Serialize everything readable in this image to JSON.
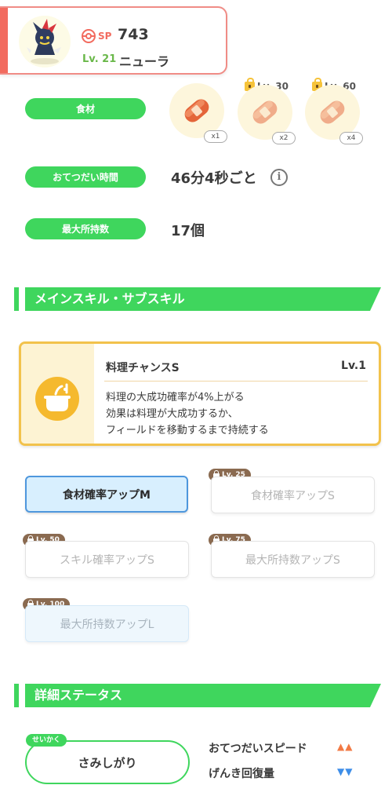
{
  "header": {
    "sp_label": "SP",
    "sp_value": "743",
    "level": "Lv. 21",
    "name": "ニューラ"
  },
  "ingredients": {
    "label": "食材",
    "items": [
      {
        "qty": "x1",
        "unlock": ""
      },
      {
        "qty": "x2",
        "unlock": "Lv. 30"
      },
      {
        "qty": "x4",
        "unlock": "Lv. 60"
      }
    ]
  },
  "help_time": {
    "label": "おてつだい時間",
    "value": "46分4秒ごと"
  },
  "max_carry": {
    "label": "最大所持数",
    "value": "17個"
  },
  "skills_section": {
    "title": "メインスキル・サブスキル"
  },
  "main_skill": {
    "name": "料理チャンスS",
    "level": "Lv.1",
    "desc1": "料理の大成功確率が4%上がる",
    "desc2": "効果は料理が大成功するか、",
    "desc3": "フィールドを移動するまで持続する"
  },
  "sub_skills": [
    {
      "label": "食材確率アップM",
      "lock": ""
    },
    {
      "label": "食材確率アップS",
      "lock": "Lv. 25"
    },
    {
      "label": "スキル確率アップS",
      "lock": "Lv. 50"
    },
    {
      "label": "最大所持数アップS",
      "lock": "Lv. 75"
    },
    {
      "label": "最大所持数アップL",
      "lock": "Lv. 100"
    }
  ],
  "status_section": {
    "title": "詳細ステータス"
  },
  "nature": {
    "tag": "せいかく",
    "value": "さみしがり"
  },
  "stats": [
    {
      "label": "おてつだいスピード",
      "arrows": "▲▲",
      "color": "#f27a45"
    },
    {
      "label": "げんき回復量",
      "arrows": "▼▼",
      "color": "#3e8ee8"
    }
  ],
  "colors": {
    "accent_green": "#3fd65d",
    "accent_red": "#f26b5f",
    "skill_gold": "#f2c24c"
  }
}
